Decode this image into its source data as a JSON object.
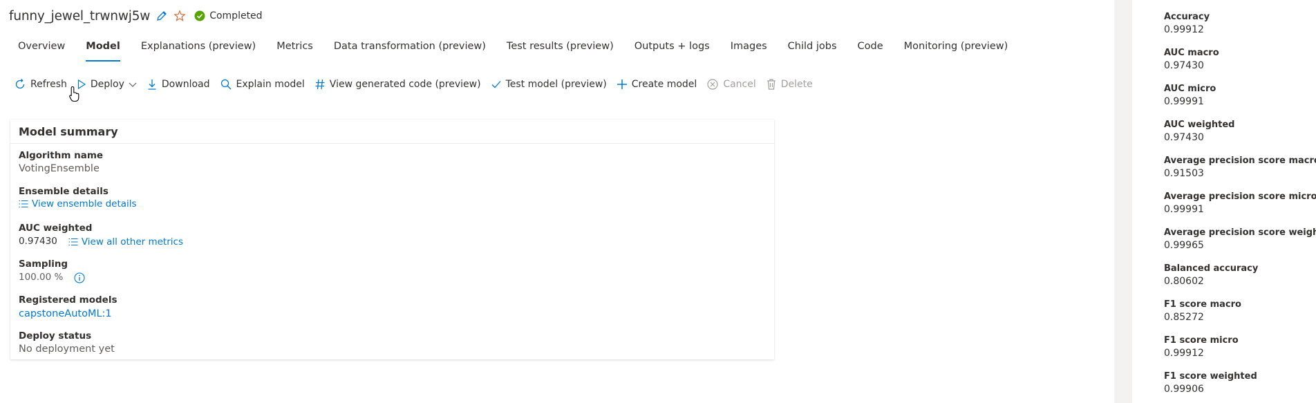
{
  "run": {
    "title": "funny_jewel_trwnwj5w",
    "status": "Completed"
  },
  "tabs": [
    {
      "label": "Overview",
      "active": false
    },
    {
      "label": "Model",
      "active": true
    },
    {
      "label": "Explanations (preview)",
      "active": false
    },
    {
      "label": "Metrics",
      "active": false
    },
    {
      "label": "Data transformation (preview)",
      "active": false
    },
    {
      "label": "Test results (preview)",
      "active": false
    },
    {
      "label": "Outputs + logs",
      "active": false
    },
    {
      "label": "Images",
      "active": false
    },
    {
      "label": "Child jobs",
      "active": false
    },
    {
      "label": "Code",
      "active": false
    },
    {
      "label": "Monitoring (preview)",
      "active": false
    }
  ],
  "toolbar": {
    "refresh": "Refresh",
    "deploy": "Deploy",
    "download": "Download",
    "explain": "Explain model",
    "view_code": "View generated code (preview)",
    "test_model": "Test model (preview)",
    "create_model": "Create model",
    "cancel": "Cancel",
    "delete": "Delete"
  },
  "summary": {
    "title": "Model summary",
    "algorithm_label": "Algorithm name",
    "algorithm_value": "VotingEnsemble",
    "ensemble_label": "Ensemble details",
    "ensemble_link": "View ensemble details",
    "auc_label": "AUC weighted",
    "auc_value": "0.97430",
    "metrics_link": "View all other metrics",
    "sampling_label": "Sampling",
    "sampling_value": "100.00 %",
    "registered_label": "Registered models",
    "registered_value": "capstoneAutoML:1",
    "deploy_label": "Deploy status",
    "deploy_value": "No deployment yet"
  },
  "metrics": [
    {
      "label": "Accuracy",
      "value": "0.99912"
    },
    {
      "label": "AUC macro",
      "value": "0.97430"
    },
    {
      "label": "AUC micro",
      "value": "0.99991"
    },
    {
      "label": "AUC weighted",
      "value": "0.97430"
    },
    {
      "label": "Average precision score macro",
      "value": "0.91503"
    },
    {
      "label": "Average precision score micro",
      "value": "0.99991"
    },
    {
      "label": "Average precision score weighted",
      "value": "0.99965"
    },
    {
      "label": "Balanced accuracy",
      "value": "0.80602"
    },
    {
      "label": "F1 score macro",
      "value": "0.85272"
    },
    {
      "label": "F1 score micro",
      "value": "0.99912"
    },
    {
      "label": "F1 score weighted",
      "value": "0.99906"
    }
  ],
  "colors": {
    "accent": "#0078d4",
    "success": "#57a300",
    "star": "#d9653b"
  }
}
